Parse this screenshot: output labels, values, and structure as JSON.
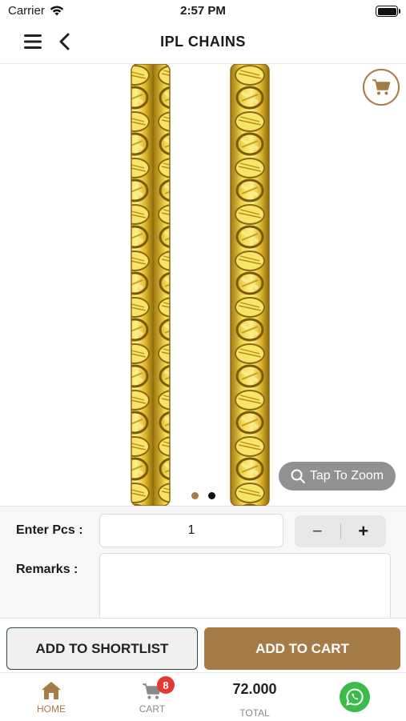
{
  "status_bar": {
    "carrier": "Carrier",
    "time": "2:57 PM"
  },
  "nav": {
    "title": "IPL CHAINS"
  },
  "gallery": {
    "zoom_label": "Tap To Zoom",
    "image_count": 2,
    "active_index": 1
  },
  "form": {
    "pcs_label": "Enter Pcs :",
    "pcs_value": "1",
    "minus_label": "−",
    "plus_label": "+",
    "remarks_label": "Remarks :",
    "remarks_value": ""
  },
  "actions": {
    "shortlist_label": "ADD TO SHORTLIST",
    "add_to_cart_label": "ADD TO CART"
  },
  "tabbar": {
    "home_label": "HOME",
    "cart_label": "CART",
    "cart_badge": "8",
    "total_value": "72.000",
    "total_label": "TOTAL"
  },
  "colors": {
    "accent": "#a57b47",
    "badge": "#e53935",
    "whatsapp": "#3dbb4a",
    "gold_light": "#f6df5a",
    "gold_dark": "#b98d12"
  }
}
